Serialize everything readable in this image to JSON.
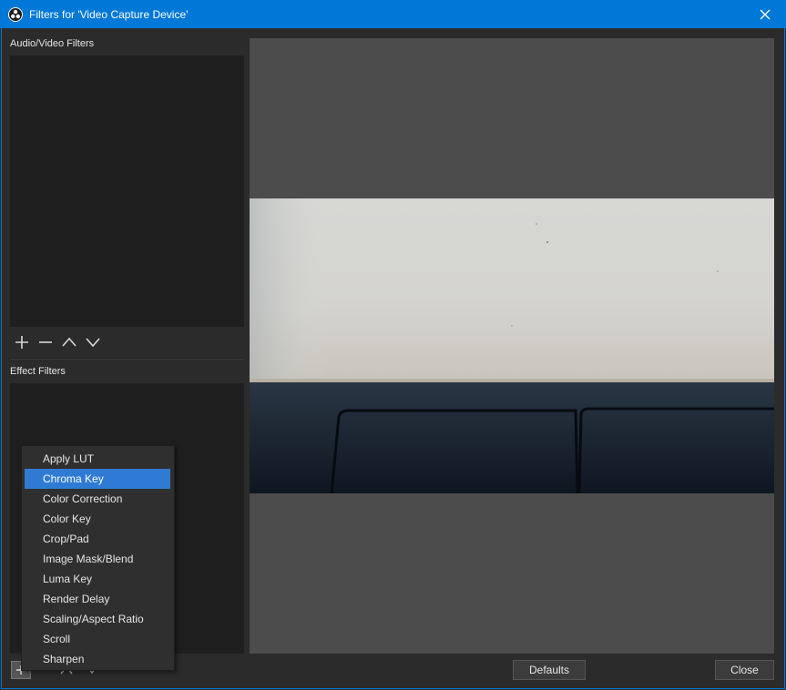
{
  "window": {
    "title": "Filters for 'Video Capture Device'",
    "accent": "#0078d7"
  },
  "audio_video_filters": {
    "label": "Audio/Video Filters",
    "toolbar_icons": [
      "plus-icon",
      "minus-icon",
      "chevron-up-icon",
      "chevron-down-icon"
    ]
  },
  "effect_filters": {
    "label": "Effect Filters"
  },
  "context_menu": {
    "items": [
      {
        "label": "Apply LUT"
      },
      {
        "label": "Chroma Key"
      },
      {
        "label": "Color Correction"
      },
      {
        "label": "Color Key"
      },
      {
        "label": "Crop/Pad"
      },
      {
        "label": "Image Mask/Blend"
      },
      {
        "label": "Luma Key"
      },
      {
        "label": "Render Delay"
      },
      {
        "label": "Scaling/Aspect Ratio"
      },
      {
        "label": "Scroll"
      },
      {
        "label": "Sharpen"
      }
    ],
    "selected": "Chroma Key",
    "highlight_color": "#2f7bd3"
  },
  "buttons": {
    "defaults": "Defaults",
    "close": "Close"
  }
}
